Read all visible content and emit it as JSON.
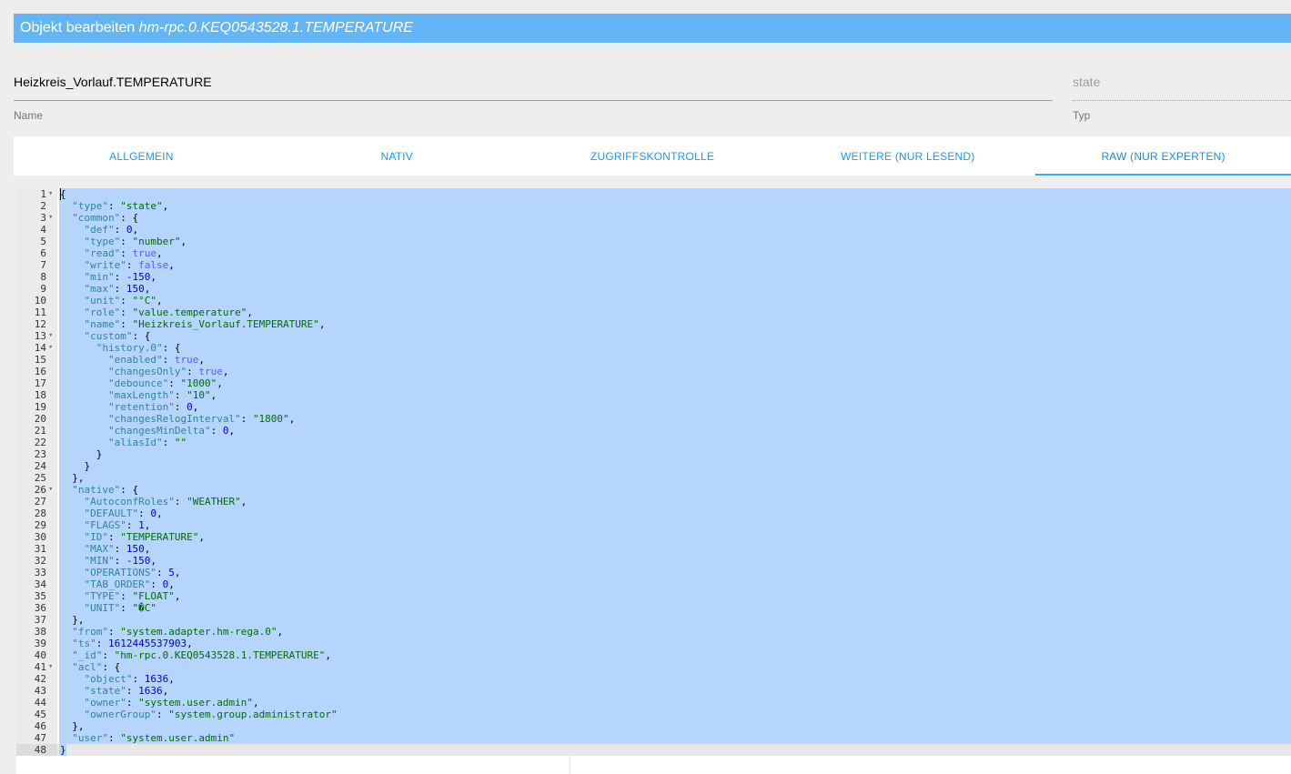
{
  "dialog": {
    "title_prefix": "Objekt bearbeiten",
    "object_id": "hm-rpc.0.KEQ0543528.1.TEMPERATURE"
  },
  "fields": {
    "name_value": "Heizkreis_Vorlauf.TEMPERATURE",
    "name_label": "Name",
    "type_value": "state",
    "type_label": "Typ"
  },
  "tabs": [
    {
      "label": "ALLGEMEIN",
      "active": false
    },
    {
      "label": "NATIV",
      "active": false
    },
    {
      "label": "ZUGRIFFSKONTROLLE",
      "active": false
    },
    {
      "label": "WEITERE (NUR LESEND)",
      "active": false
    },
    {
      "label": "RAW (NUR EXPERTEN)",
      "active": true
    }
  ],
  "editor": {
    "lines": [
      {
        "n": "1",
        "fold": true,
        "indent": 0,
        "tokens": [
          [
            "p",
            "{"
          ]
        ]
      },
      {
        "n": "2",
        "fold": false,
        "indent": 1,
        "tokens": [
          [
            "k",
            "\"type\""
          ],
          [
            "p",
            ": "
          ],
          [
            "sv",
            "\"state\""
          ],
          [
            "p",
            ","
          ]
        ]
      },
      {
        "n": "3",
        "fold": true,
        "indent": 1,
        "tokens": [
          [
            "k",
            "\"common\""
          ],
          [
            "p",
            ": {"
          ]
        ]
      },
      {
        "n": "4",
        "fold": false,
        "indent": 2,
        "tokens": [
          [
            "k",
            "\"def\""
          ],
          [
            "p",
            ": "
          ],
          [
            "n",
            "0"
          ],
          [
            "p",
            ","
          ]
        ]
      },
      {
        "n": "5",
        "fold": false,
        "indent": 2,
        "tokens": [
          [
            "k",
            "\"type\""
          ],
          [
            "p",
            ": "
          ],
          [
            "sv",
            "\"number\""
          ],
          [
            "p",
            ","
          ]
        ]
      },
      {
        "n": "6",
        "fold": false,
        "indent": 2,
        "tokens": [
          [
            "k",
            "\"read\""
          ],
          [
            "p",
            ": "
          ],
          [
            "b",
            "true"
          ],
          [
            "p",
            ","
          ]
        ]
      },
      {
        "n": "7",
        "fold": false,
        "indent": 2,
        "tokens": [
          [
            "k",
            "\"write\""
          ],
          [
            "p",
            ": "
          ],
          [
            "b",
            "false"
          ],
          [
            "p",
            ","
          ]
        ]
      },
      {
        "n": "8",
        "fold": false,
        "indent": 2,
        "tokens": [
          [
            "k",
            "\"min\""
          ],
          [
            "p",
            ": "
          ],
          [
            "n",
            "-150"
          ],
          [
            "p",
            ","
          ]
        ]
      },
      {
        "n": "9",
        "fold": false,
        "indent": 2,
        "tokens": [
          [
            "k",
            "\"max\""
          ],
          [
            "p",
            ": "
          ],
          [
            "n",
            "150"
          ],
          [
            "p",
            ","
          ]
        ]
      },
      {
        "n": "10",
        "fold": false,
        "indent": 2,
        "tokens": [
          [
            "k",
            "\"unit\""
          ],
          [
            "p",
            ": "
          ],
          [
            "sv",
            "\"°C\""
          ],
          [
            "p",
            ","
          ]
        ]
      },
      {
        "n": "11",
        "fold": false,
        "indent": 2,
        "tokens": [
          [
            "k",
            "\"role\""
          ],
          [
            "p",
            ": "
          ],
          [
            "sv",
            "\"value.temperature\""
          ],
          [
            "p",
            ","
          ]
        ]
      },
      {
        "n": "12",
        "fold": false,
        "indent": 2,
        "tokens": [
          [
            "k",
            "\"name\""
          ],
          [
            "p",
            ": "
          ],
          [
            "sv",
            "\"Heizkreis_Vorlauf.TEMPERATURE\""
          ],
          [
            "p",
            ","
          ]
        ]
      },
      {
        "n": "13",
        "fold": true,
        "indent": 2,
        "tokens": [
          [
            "k",
            "\"custom\""
          ],
          [
            "p",
            ": {"
          ]
        ]
      },
      {
        "n": "14",
        "fold": true,
        "indent": 3,
        "tokens": [
          [
            "k",
            "\"history.0\""
          ],
          [
            "p",
            ": {"
          ]
        ]
      },
      {
        "n": "15",
        "fold": false,
        "indent": 4,
        "tokens": [
          [
            "k",
            "\"enabled\""
          ],
          [
            "p",
            ": "
          ],
          [
            "b",
            "true"
          ],
          [
            "p",
            ","
          ]
        ]
      },
      {
        "n": "16",
        "fold": false,
        "indent": 4,
        "tokens": [
          [
            "k",
            "\"changesOnly\""
          ],
          [
            "p",
            ": "
          ],
          [
            "b",
            "true"
          ],
          [
            "p",
            ","
          ]
        ]
      },
      {
        "n": "17",
        "fold": false,
        "indent": 4,
        "tokens": [
          [
            "k",
            "\"debounce\""
          ],
          [
            "p",
            ": "
          ],
          [
            "sv",
            "\"1000\""
          ],
          [
            "p",
            ","
          ]
        ]
      },
      {
        "n": "18",
        "fold": false,
        "indent": 4,
        "tokens": [
          [
            "k",
            "\"maxLength\""
          ],
          [
            "p",
            ": "
          ],
          [
            "sv",
            "\"10\""
          ],
          [
            "p",
            ","
          ]
        ]
      },
      {
        "n": "19",
        "fold": false,
        "indent": 4,
        "tokens": [
          [
            "k",
            "\"retention\""
          ],
          [
            "p",
            ": "
          ],
          [
            "n",
            "0"
          ],
          [
            "p",
            ","
          ]
        ]
      },
      {
        "n": "20",
        "fold": false,
        "indent": 4,
        "tokens": [
          [
            "k",
            "\"changesRelogInterval\""
          ],
          [
            "p",
            ": "
          ],
          [
            "sv",
            "\"1800\""
          ],
          [
            "p",
            ","
          ]
        ]
      },
      {
        "n": "21",
        "fold": false,
        "indent": 4,
        "tokens": [
          [
            "k",
            "\"changesMinDelta\""
          ],
          [
            "p",
            ": "
          ],
          [
            "n",
            "0"
          ],
          [
            "p",
            ","
          ]
        ]
      },
      {
        "n": "22",
        "fold": false,
        "indent": 4,
        "tokens": [
          [
            "k",
            "\"aliasId\""
          ],
          [
            "p",
            ": "
          ],
          [
            "sv",
            "\"\""
          ]
        ]
      },
      {
        "n": "23",
        "fold": false,
        "indent": 3,
        "tokens": [
          [
            "p",
            "}"
          ]
        ]
      },
      {
        "n": "24",
        "fold": false,
        "indent": 2,
        "tokens": [
          [
            "p",
            "}"
          ]
        ]
      },
      {
        "n": "25",
        "fold": false,
        "indent": 1,
        "tokens": [
          [
            "p",
            "},"
          ]
        ]
      },
      {
        "n": "26",
        "fold": true,
        "indent": 1,
        "tokens": [
          [
            "k",
            "\"native\""
          ],
          [
            "p",
            ": {"
          ]
        ]
      },
      {
        "n": "27",
        "fold": false,
        "indent": 2,
        "tokens": [
          [
            "k",
            "\"AutoconfRoles\""
          ],
          [
            "p",
            ": "
          ],
          [
            "sv",
            "\"WEATHER\""
          ],
          [
            "p",
            ","
          ]
        ]
      },
      {
        "n": "28",
        "fold": false,
        "indent": 2,
        "tokens": [
          [
            "k",
            "\"DEFAULT\""
          ],
          [
            "p",
            ": "
          ],
          [
            "n",
            "0"
          ],
          [
            "p",
            ","
          ]
        ]
      },
      {
        "n": "29",
        "fold": false,
        "indent": 2,
        "tokens": [
          [
            "k",
            "\"FLAGS\""
          ],
          [
            "p",
            ": "
          ],
          [
            "n",
            "1"
          ],
          [
            "p",
            ","
          ]
        ]
      },
      {
        "n": "30",
        "fold": false,
        "indent": 2,
        "tokens": [
          [
            "k",
            "\"ID\""
          ],
          [
            "p",
            ": "
          ],
          [
            "sv",
            "\"TEMPERATURE\""
          ],
          [
            "p",
            ","
          ]
        ]
      },
      {
        "n": "31",
        "fold": false,
        "indent": 2,
        "tokens": [
          [
            "k",
            "\"MAX\""
          ],
          [
            "p",
            ": "
          ],
          [
            "n",
            "150"
          ],
          [
            "p",
            ","
          ]
        ]
      },
      {
        "n": "32",
        "fold": false,
        "indent": 2,
        "tokens": [
          [
            "k",
            "\"MIN\""
          ],
          [
            "p",
            ": "
          ],
          [
            "n",
            "-150"
          ],
          [
            "p",
            ","
          ]
        ]
      },
      {
        "n": "33",
        "fold": false,
        "indent": 2,
        "tokens": [
          [
            "k",
            "\"OPERATIONS\""
          ],
          [
            "p",
            ": "
          ],
          [
            "n",
            "5"
          ],
          [
            "p",
            ","
          ]
        ]
      },
      {
        "n": "34",
        "fold": false,
        "indent": 2,
        "tokens": [
          [
            "k",
            "\"TAB_ORDER\""
          ],
          [
            "p",
            ": "
          ],
          [
            "n",
            "0"
          ],
          [
            "p",
            ","
          ]
        ]
      },
      {
        "n": "35",
        "fold": false,
        "indent": 2,
        "tokens": [
          [
            "k",
            "\"TYPE\""
          ],
          [
            "p",
            ": "
          ],
          [
            "sv",
            "\"FLOAT\""
          ],
          [
            "p",
            ","
          ]
        ]
      },
      {
        "n": "36",
        "fold": false,
        "indent": 2,
        "tokens": [
          [
            "k",
            "\"UNIT\""
          ],
          [
            "p",
            ": "
          ],
          [
            "sv",
            "\"�C\""
          ]
        ]
      },
      {
        "n": "37",
        "fold": false,
        "indent": 1,
        "tokens": [
          [
            "p",
            "},"
          ]
        ]
      },
      {
        "n": "38",
        "fold": false,
        "indent": 1,
        "tokens": [
          [
            "k",
            "\"from\""
          ],
          [
            "p",
            ": "
          ],
          [
            "sv",
            "\"system.adapter.hm-rega.0\""
          ],
          [
            "p",
            ","
          ]
        ]
      },
      {
        "n": "39",
        "fold": false,
        "indent": 1,
        "tokens": [
          [
            "k",
            "\"ts\""
          ],
          [
            "p",
            ": "
          ],
          [
            "n",
            "1612445537903"
          ],
          [
            "p",
            ","
          ]
        ]
      },
      {
        "n": "40",
        "fold": false,
        "indent": 1,
        "tokens": [
          [
            "k",
            "\"_id\""
          ],
          [
            "p",
            ": "
          ],
          [
            "sv",
            "\"hm-rpc.0.KEQ0543528.1.TEMPERATURE\""
          ],
          [
            "p",
            ","
          ]
        ]
      },
      {
        "n": "41",
        "fold": true,
        "indent": 1,
        "tokens": [
          [
            "k",
            "\"acl\""
          ],
          [
            "p",
            ": {"
          ]
        ]
      },
      {
        "n": "42",
        "fold": false,
        "indent": 2,
        "tokens": [
          [
            "k",
            "\"object\""
          ],
          [
            "p",
            ": "
          ],
          [
            "n",
            "1636"
          ],
          [
            "p",
            ","
          ]
        ]
      },
      {
        "n": "43",
        "fold": false,
        "indent": 2,
        "tokens": [
          [
            "k",
            "\"state\""
          ],
          [
            "p",
            ": "
          ],
          [
            "n",
            "1636"
          ],
          [
            "p",
            ","
          ]
        ]
      },
      {
        "n": "44",
        "fold": false,
        "indent": 2,
        "tokens": [
          [
            "k",
            "\"owner\""
          ],
          [
            "p",
            ": "
          ],
          [
            "sv",
            "\"system.user.admin\""
          ],
          [
            "p",
            ","
          ]
        ]
      },
      {
        "n": "45",
        "fold": false,
        "indent": 2,
        "tokens": [
          [
            "k",
            "\"ownerGroup\""
          ],
          [
            "p",
            ": "
          ],
          [
            "sv",
            "\"system.group.administrator\""
          ]
        ]
      },
      {
        "n": "46",
        "fold": false,
        "indent": 1,
        "tokens": [
          [
            "p",
            "},"
          ]
        ]
      },
      {
        "n": "47",
        "fold": false,
        "indent": 1,
        "tokens": [
          [
            "k",
            "\"user\""
          ],
          [
            "p",
            ": "
          ],
          [
            "sv",
            "\"system.user.admin\""
          ]
        ]
      },
      {
        "n": "48",
        "fold": false,
        "indent": 0,
        "tokens": [
          [
            "p",
            "}"
          ]
        ]
      }
    ]
  }
}
